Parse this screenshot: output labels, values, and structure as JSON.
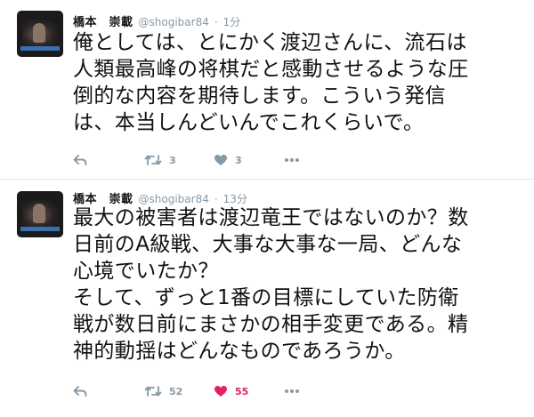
{
  "tweets": [
    {
      "display_name": "橋本　崇載",
      "handle": "@shogibar84",
      "separator": "·",
      "time": "1分",
      "text": "俺としては、とにかく渡辺さんに、流石は\n人類最高峰の将棋だと感動させるような圧\n倒的な内容を期待します。こういう発信\nは、本当しんどいんでこれくらいで。",
      "retweet_count": "3",
      "like_count": "3",
      "liked": false
    },
    {
      "display_name": "橋本　崇載",
      "handle": "@shogibar84",
      "separator": "·",
      "time": "13分",
      "text": "最大の被害者は渡辺竜王ではないのか？数\n日前のA級戦、大事な大事な一局、どんな\n心境でいたか？\nそして、ずっと1番の目標にしていた防衛\n戦が数日前にまさかの相手変更である。精\n神的動揺はどんなものであろうか。",
      "retweet_count": "52",
      "like_count": "55",
      "liked": true
    }
  ],
  "colors": {
    "text": "#14171a",
    "muted": "#8899a6",
    "like_active": "#e0245e",
    "divider": "#e1e8ed"
  },
  "icons": {
    "reply": "reply-arrow-icon",
    "retweet": "retweet-icon",
    "like": "heart-icon",
    "more": "more-dots-icon"
  }
}
